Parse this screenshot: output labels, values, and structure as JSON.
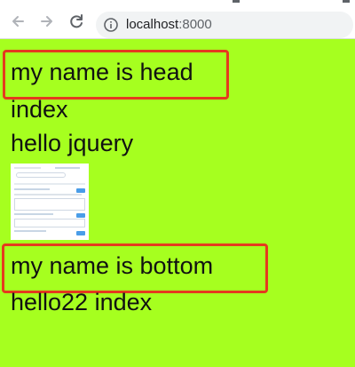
{
  "browser": {
    "url_host": "localhost",
    "url_port": ":8000",
    "icons": [
      "back-arrow-icon",
      "forward-arrow-icon",
      "reload-icon",
      "info-icon"
    ]
  },
  "page": {
    "background": "#a6ff1f",
    "highlight_color": "#e53a1e",
    "lines": {
      "head": "my name is head",
      "index": "index",
      "hello": "hello jquery",
      "bottom": "my name is bottom",
      "hello22": "hello22 index"
    }
  }
}
